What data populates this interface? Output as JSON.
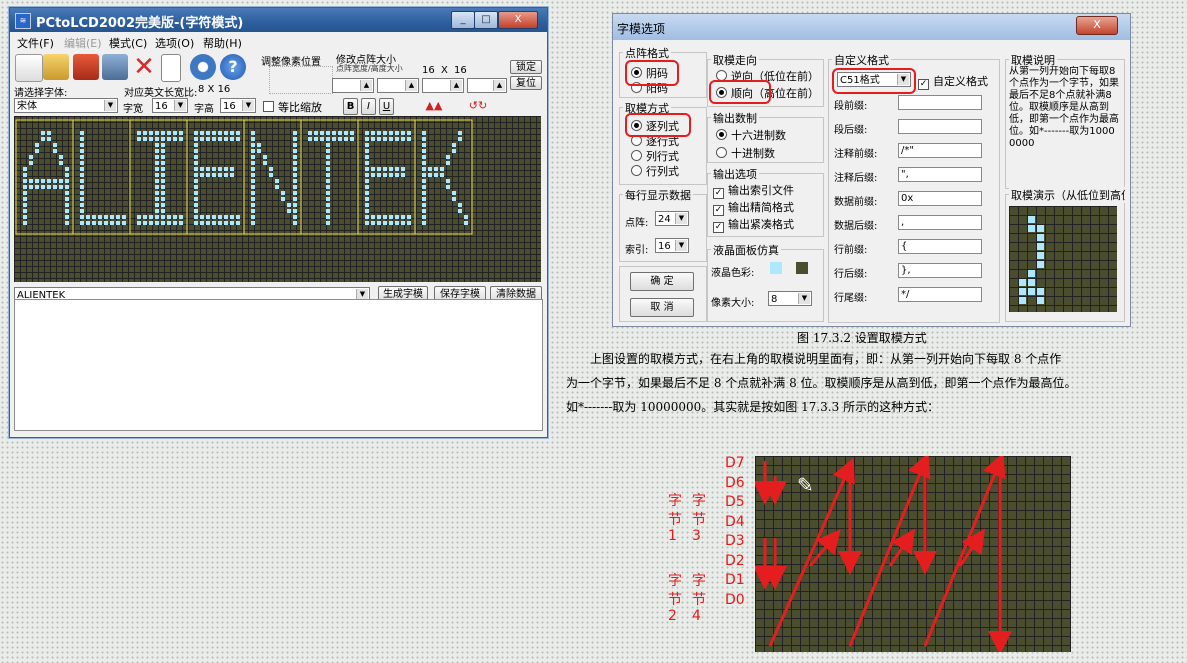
{
  "window": {
    "title": "PCtoLCD2002完美版-(字符模式)",
    "controls": [
      "_",
      "□",
      "X"
    ],
    "menu": [
      "文件(F)",
      "编辑(E)",
      "模式(C)",
      "选项(O)",
      "帮助(H)"
    ],
    "adjust_label": "调整像素位置",
    "dot_size_label": "修改点阵大小",
    "dot_size_sub": "点阵宽度/高度大小",
    "dot_w": "16",
    "dot_x": "X",
    "dot_h": "16",
    "lock_btn": "锁定",
    "restore_btn": "复位",
    "font_label": "请选择字体:",
    "ratio_label": "对应英文长宽比:",
    "ratio_value": "8 X 16",
    "font_value": "宋体",
    "width_label": "字宽",
    "width_value": "16",
    "height_label": "字高",
    "height_value": "16",
    "scale_label": "等比缩放",
    "style_btns": [
      "B",
      "I",
      "U"
    ],
    "text_value": "ALIENTEK",
    "btn_generate": "生成字模",
    "btn_save": "保存字模",
    "btn_clear": "清除数据",
    "preview_text": "ALIENTEK"
  },
  "dialog": {
    "title": "字模选项",
    "close": "X",
    "dot_format": {
      "title": "点阵格式",
      "options": [
        "阴码",
        "阳码"
      ],
      "selected": 0
    },
    "mode": {
      "title": "取模方式",
      "options": [
        "逐列式",
        "逐行式",
        "列行式",
        "行列式"
      ],
      "selected": 0
    },
    "per_row": {
      "title": "每行显示数据",
      "dot_label": "点阵:",
      "dot_value": "24",
      "index_label": "索引:",
      "index_value": "16"
    },
    "direction": {
      "title": "取模走向",
      "options": [
        "逆向（低位在前）",
        "顺向（高位在前）"
      ],
      "selected": 1
    },
    "base": {
      "title": "输出数制",
      "options": [
        "十六进制数",
        "十进制数"
      ],
      "selected": 0
    },
    "output": {
      "title": "输出选项",
      "options": [
        "输出索引文件",
        "输出精简格式",
        "输出紧凑格式"
      ]
    },
    "lcd": {
      "title": "液晶面板仿真",
      "color_label": "液晶色彩:",
      "pixel_label": "像素大小:",
      "pixel_value": "8"
    },
    "ok": "确  定",
    "cancel": "取  消",
    "custom": {
      "title": "自定义格式",
      "format": "C51格式",
      "custom_check": "自定义格式",
      "rows": [
        {
          "label": "段前缀:",
          "value": ""
        },
        {
          "label": "段后缀:",
          "value": ""
        },
        {
          "label": "注释前缀:",
          "value": "/*\""
        },
        {
          "label": "注释后缀:",
          "value": "\","
        },
        {
          "label": "数据前缀:",
          "value": "0x"
        },
        {
          "label": "数据后缀:",
          "value": ","
        },
        {
          "label": "行前缀:",
          "value": "{"
        },
        {
          "label": "行后缀:",
          "value": "},"
        },
        {
          "label": "行尾缀:",
          "value": "*/"
        }
      ]
    },
    "explain": {
      "title": "取模说明",
      "text": "从第一列开始向下每取8个点作为一个字节，如果最后不足8个点就补满8位。取模顺序是从高到低，即第一个点作为最高位。如*-------取为10000000"
    },
    "demo_title": "取模演示（从低位到高位）"
  },
  "caption": "图 17.3.2  设置取模方式",
  "paragraph": [
    "上图设置的取模方式，在右上角的取模说明里面有，即：从第一列开始向下每取 8 个点作",
    "为一个字节，如果最后不足 8 个点就补满 8 位。取模顺序是从高到低，即第一个点作为最高位。",
    "如*-------取为 10000000。其实就是按如图 17.3.3 所示的这种方式："
  ],
  "diagram": {
    "bits": [
      "D7",
      "D6",
      "D5",
      "D4",
      "D3",
      "D2",
      "D1",
      "D0"
    ],
    "byte_labels": [
      {
        "chars": [
          "字",
          "节",
          "1"
        ]
      },
      {
        "chars": [
          "字",
          "节",
          "3"
        ]
      },
      {
        "chars": [
          "字",
          "节",
          "2"
        ]
      },
      {
        "chars": [
          "字",
          "节",
          "4"
        ]
      }
    ]
  },
  "colors": {
    "grid_bg": "#4a4d2e",
    "lit_pixel": "#aee8ff",
    "highlight": "#e41e1e",
    "frame": "#e6d84a"
  }
}
